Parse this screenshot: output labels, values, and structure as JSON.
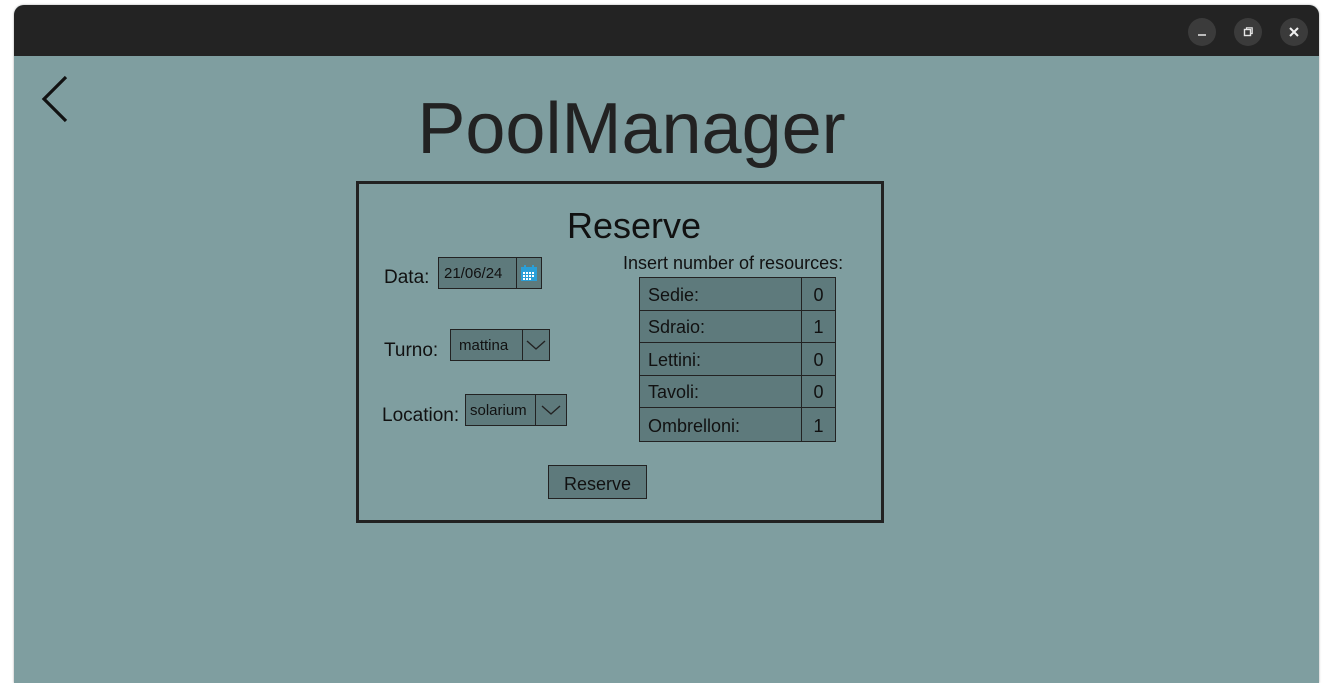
{
  "app": {
    "title": "PoolManager"
  },
  "window_controls": {
    "minimize_icon": "minimize-icon",
    "restore_icon": "restore-icon",
    "close_icon": "close-icon"
  },
  "nav": {
    "back_icon": "chevron-left-icon"
  },
  "reserve_form": {
    "title": "Reserve",
    "date": {
      "label": "Data:",
      "value": "21/06/24",
      "icon": "calendar-icon"
    },
    "shift": {
      "label": "Turno:",
      "value": "mattina",
      "icon": "chevron-down-icon"
    },
    "location": {
      "label": "Location:",
      "value": "solarium",
      "icon": "chevron-down-icon"
    },
    "resources_label": "Insert number of resources:",
    "resources": [
      {
        "name": "Sedie:",
        "value": "0"
      },
      {
        "name": "Sdraio:",
        "value": "1"
      },
      {
        "name": "Lettini:",
        "value": "0"
      },
      {
        "name": "Tavoli:",
        "value": "0"
      },
      {
        "name": "Ombrelloni:",
        "value": "1"
      }
    ],
    "submit_label": "Reserve"
  },
  "colors": {
    "background": "#7f9ea0",
    "field": "#5e7a7c",
    "titlebar": "#232323",
    "calendar_accent": "#2a9fd8"
  }
}
